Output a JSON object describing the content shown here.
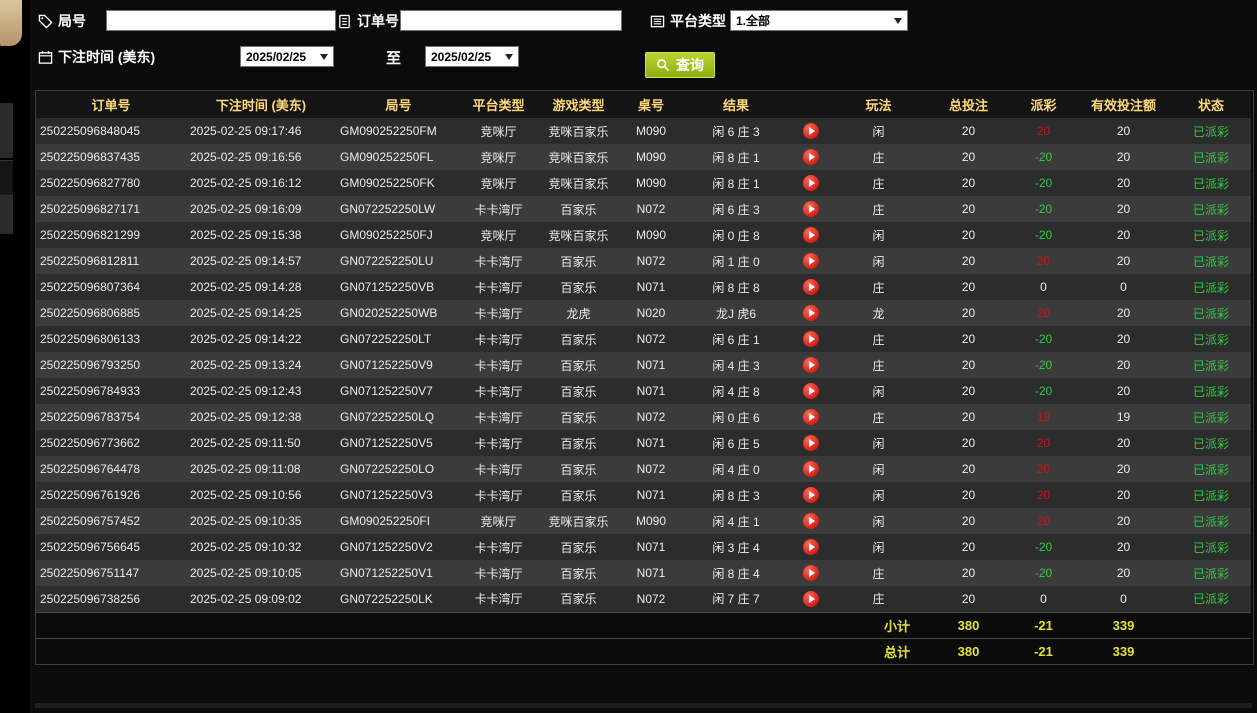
{
  "filters": {
    "round": {
      "label": "局号",
      "value": ""
    },
    "order": {
      "label": "订单号",
      "value": ""
    },
    "platform": {
      "label": "平台类型",
      "value": "1.全部"
    },
    "bet_time": {
      "label": "下注时间 (美东)",
      "from": "2025/02/25",
      "to_label": "至",
      "to": "2025/02/25"
    },
    "query_label": "查询"
  },
  "table": {
    "headers": [
      "订单号",
      "下注时间 (美东)",
      "局号",
      "平台类型",
      "游戏类型",
      "桌号",
      "结果",
      "",
      "玩法",
      "总投注",
      "派彩",
      "有效投注额",
      "状态"
    ],
    "rows": [
      {
        "order": "250225096848045",
        "time": "2025-02-25 09:17:46",
        "round": "GM090252250FM",
        "platform": "竞咪厅",
        "game": "竞咪百家乐",
        "table_no": "M090",
        "result": "闲 6 庄 3",
        "play": "闲",
        "total": "20",
        "payout": "20",
        "valid": "20",
        "status": "已派彩"
      },
      {
        "order": "250225096837435",
        "time": "2025-02-25 09:16:56",
        "round": "GM090252250FL",
        "platform": "竞咪厅",
        "game": "竞咪百家乐",
        "table_no": "M090",
        "result": "闲 8 庄 1",
        "play": "庄",
        "total": "20",
        "payout": "-20",
        "valid": "20",
        "status": "已派彩"
      },
      {
        "order": "250225096827780",
        "time": "2025-02-25 09:16:12",
        "round": "GM090252250FK",
        "platform": "竞咪厅",
        "game": "竞咪百家乐",
        "table_no": "M090",
        "result": "闲 8 庄 1",
        "play": "庄",
        "total": "20",
        "payout": "-20",
        "valid": "20",
        "status": "已派彩"
      },
      {
        "order": "250225096827171",
        "time": "2025-02-25 09:16:09",
        "round": "GN072252250LW",
        "platform": "卡卡湾厅",
        "game": "百家乐",
        "table_no": "N072",
        "result": "闲 6 庄 3",
        "play": "庄",
        "total": "20",
        "payout": "-20",
        "valid": "20",
        "status": "已派彩"
      },
      {
        "order": "250225096821299",
        "time": "2025-02-25 09:15:38",
        "round": "GM090252250FJ",
        "platform": "竞咪厅",
        "game": "竞咪百家乐",
        "table_no": "M090",
        "result": "闲 0 庄 8",
        "play": "闲",
        "total": "20",
        "payout": "-20",
        "valid": "20",
        "status": "已派彩"
      },
      {
        "order": "250225096812811",
        "time": "2025-02-25 09:14:57",
        "round": "GN072252250LU",
        "platform": "卡卡湾厅",
        "game": "百家乐",
        "table_no": "N072",
        "result": "闲 1 庄 0",
        "play": "闲",
        "total": "20",
        "payout": "20",
        "valid": "20",
        "status": "已派彩"
      },
      {
        "order": "250225096807364",
        "time": "2025-02-25 09:14:28",
        "round": "GN071252250VB",
        "platform": "卡卡湾厅",
        "game": "百家乐",
        "table_no": "N071",
        "result": "闲 8 庄 8",
        "play": "庄",
        "total": "20",
        "payout": "0",
        "valid": "0",
        "status": "已派彩"
      },
      {
        "order": "250225096806885",
        "time": "2025-02-25 09:14:25",
        "round": "GN020252250WB",
        "platform": "卡卡湾厅",
        "game": "龙虎",
        "table_no": "N020",
        "result": "龙J 虎6",
        "play": "龙",
        "total": "20",
        "payout": "20",
        "valid": "20",
        "status": "已派彩"
      },
      {
        "order": "250225096806133",
        "time": "2025-02-25 09:14:22",
        "round": "GN072252250LT",
        "platform": "卡卡湾厅",
        "game": "百家乐",
        "table_no": "N072",
        "result": "闲 6 庄 1",
        "play": "庄",
        "total": "20",
        "payout": "-20",
        "valid": "20",
        "status": "已派彩"
      },
      {
        "order": "250225096793250",
        "time": "2025-02-25 09:13:24",
        "round": "GN071252250V9",
        "platform": "卡卡湾厅",
        "game": "百家乐",
        "table_no": "N071",
        "result": "闲 4 庄 3",
        "play": "庄",
        "total": "20",
        "payout": "-20",
        "valid": "20",
        "status": "已派彩"
      },
      {
        "order": "250225096784933",
        "time": "2025-02-25 09:12:43",
        "round": "GN071252250V7",
        "platform": "卡卡湾厅",
        "game": "百家乐",
        "table_no": "N071",
        "result": "闲 4 庄 8",
        "play": "闲",
        "total": "20",
        "payout": "-20",
        "valid": "20",
        "status": "已派彩"
      },
      {
        "order": "250225096783754",
        "time": "2025-02-25 09:12:38",
        "round": "GN072252250LQ",
        "platform": "卡卡湾厅",
        "game": "百家乐",
        "table_no": "N072",
        "result": "闲 0 庄 6",
        "play": "庄",
        "total": "20",
        "payout": "19",
        "valid": "19",
        "status": "已派彩"
      },
      {
        "order": "250225096773662",
        "time": "2025-02-25 09:11:50",
        "round": "GN071252250V5",
        "platform": "卡卡湾厅",
        "game": "百家乐",
        "table_no": "N071",
        "result": "闲 6 庄 5",
        "play": "闲",
        "total": "20",
        "payout": "20",
        "valid": "20",
        "status": "已派彩"
      },
      {
        "order": "250225096764478",
        "time": "2025-02-25 09:11:08",
        "round": "GN072252250LO",
        "platform": "卡卡湾厅",
        "game": "百家乐",
        "table_no": "N072",
        "result": "闲 4 庄 0",
        "play": "闲",
        "total": "20",
        "payout": "20",
        "valid": "20",
        "status": "已派彩"
      },
      {
        "order": "250225096761926",
        "time": "2025-02-25 09:10:56",
        "round": "GN071252250V3",
        "platform": "卡卡湾厅",
        "game": "百家乐",
        "table_no": "N071",
        "result": "闲 8 庄 3",
        "play": "闲",
        "total": "20",
        "payout": "20",
        "valid": "20",
        "status": "已派彩"
      },
      {
        "order": "250225096757452",
        "time": "2025-02-25 09:10:35",
        "round": "GM090252250FI",
        "platform": "竞咪厅",
        "game": "竞咪百家乐",
        "table_no": "M090",
        "result": "闲 4 庄 1",
        "play": "闲",
        "total": "20",
        "payout": "20",
        "valid": "20",
        "status": "已派彩"
      },
      {
        "order": "250225096756645",
        "time": "2025-02-25 09:10:32",
        "round": "GN071252250V2",
        "platform": "卡卡湾厅",
        "game": "百家乐",
        "table_no": "N071",
        "result": "闲 3 庄 4",
        "play": "闲",
        "total": "20",
        "payout": "-20",
        "valid": "20",
        "status": "已派彩"
      },
      {
        "order": "250225096751147",
        "time": "2025-02-25 09:10:05",
        "round": "GN071252250V1",
        "platform": "卡卡湾厅",
        "game": "百家乐",
        "table_no": "N071",
        "result": "闲 8 庄 4",
        "play": "庄",
        "total": "20",
        "payout": "-20",
        "valid": "20",
        "status": "已派彩"
      },
      {
        "order": "250225096738256",
        "time": "2025-02-25 09:09:02",
        "round": "GN072252250LK",
        "platform": "卡卡湾厅",
        "game": "百家乐",
        "table_no": "N072",
        "result": "闲 7 庄 7",
        "play": "庄",
        "total": "20",
        "payout": "0",
        "valid": "0",
        "status": "已派彩"
      }
    ]
  },
  "summary": {
    "rows": [
      {
        "label": "小计",
        "total": "380",
        "payout": "-21",
        "valid": "339"
      },
      {
        "label": "总计",
        "total": "380",
        "payout": "-21",
        "valid": "339"
      }
    ]
  }
}
